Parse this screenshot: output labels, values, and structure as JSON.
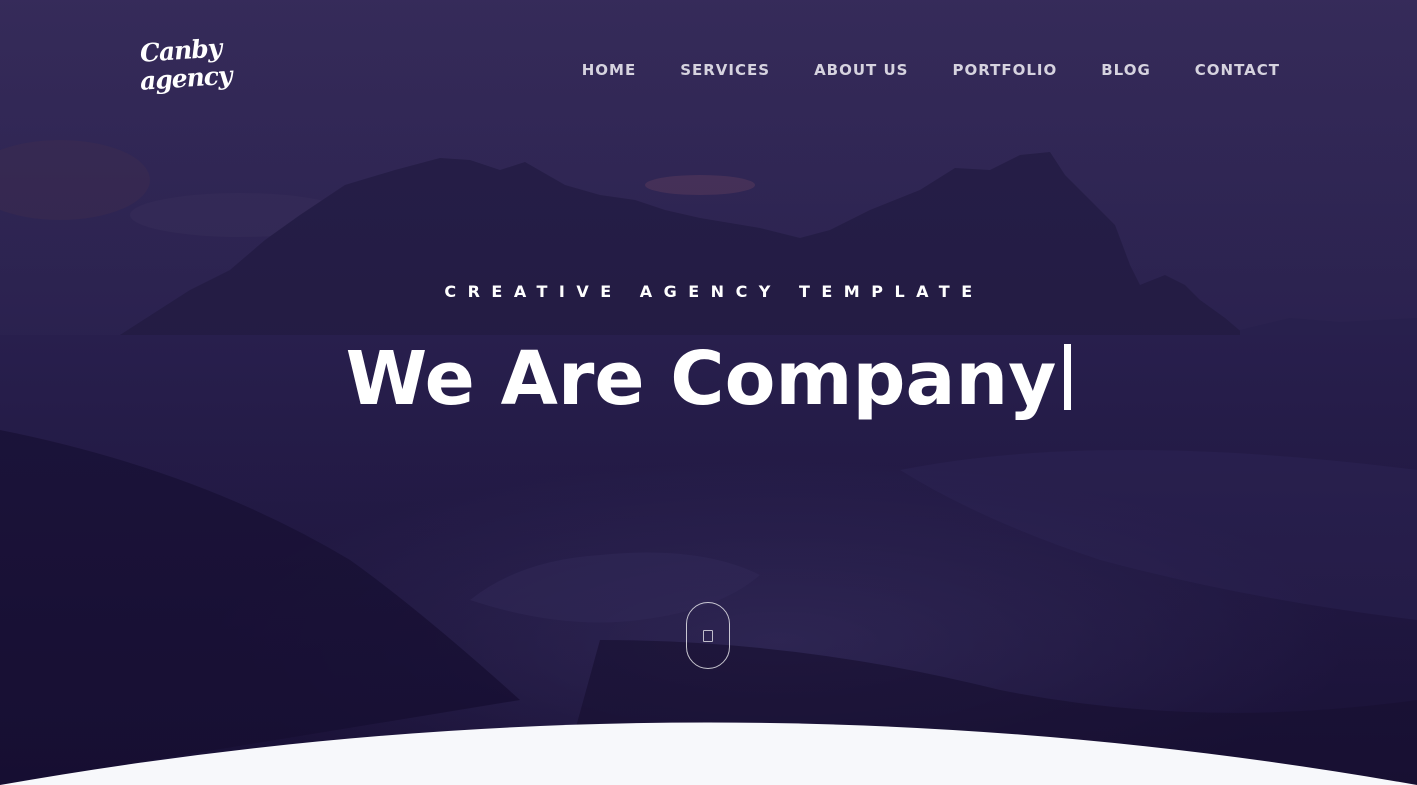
{
  "logo": {
    "line1": "Canby",
    "line2": "agency"
  },
  "nav": {
    "items": [
      {
        "label": "HOME"
      },
      {
        "label": "SERVICES"
      },
      {
        "label": "ABOUT US"
      },
      {
        "label": "PORTFOLIO"
      },
      {
        "label": "BLOG"
      },
      {
        "label": "CONTACT"
      }
    ]
  },
  "hero": {
    "subtitle": "CREATIVE AGENCY TEMPLATE",
    "headline": "We Are Company"
  },
  "icons": {
    "scroll": "mouse-scroll-icon"
  },
  "colors": {
    "overlay": "#241c45",
    "curve_fill": "#f7f8fb",
    "text": "#ffffff",
    "nav_text": "#d6d3df"
  }
}
